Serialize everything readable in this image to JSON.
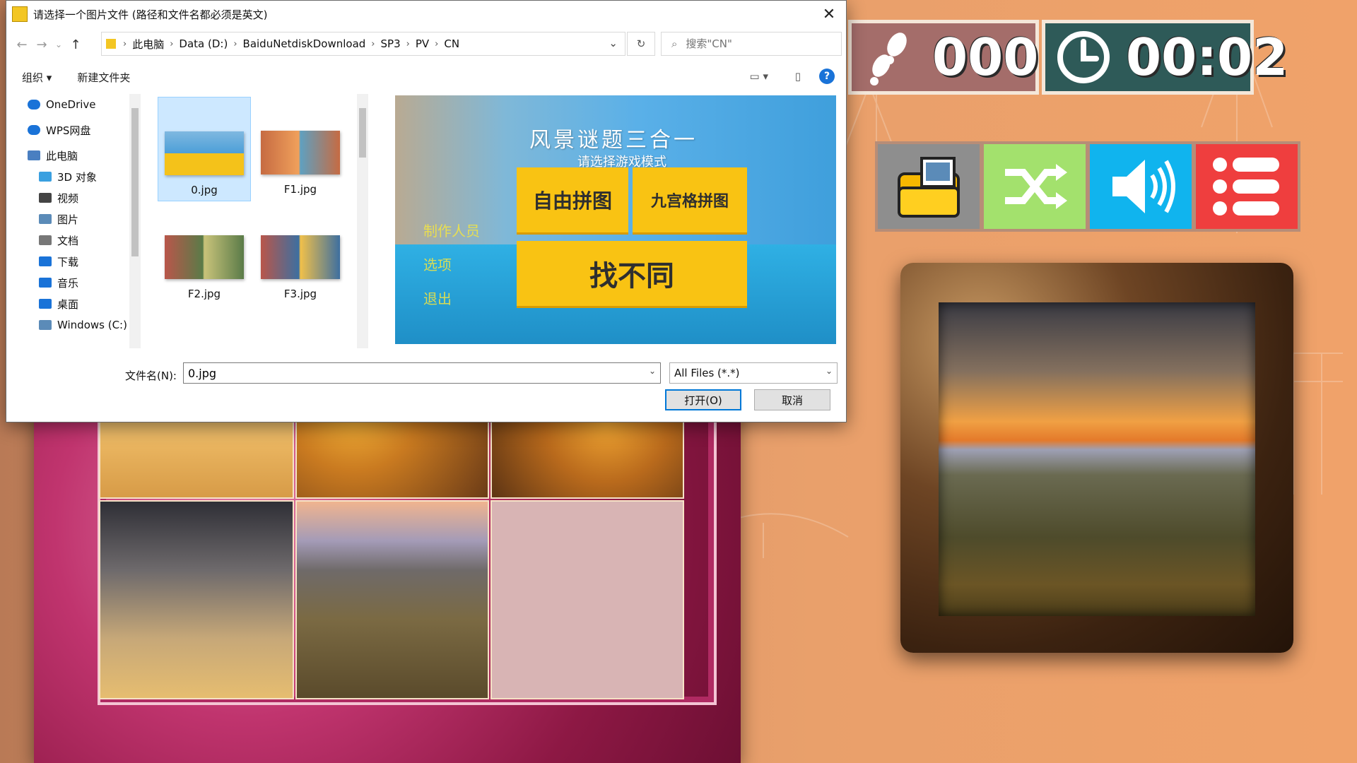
{
  "game": {
    "steps": "000",
    "timer": "00:02",
    "toolbar": [
      "folder-image-icon",
      "shuffle-icon",
      "sound-icon",
      "menu-list-icon"
    ]
  },
  "dialog": {
    "title": "请选择一个图片文件 (路径和文件名都必须是英文)",
    "breadcrumbs": [
      "此电脑",
      "Data (D:)",
      "BaiduNetdiskDownload",
      "SP3",
      "PV",
      "CN"
    ],
    "search_placeholder": "搜索\"CN\"",
    "commands": {
      "organize": "组织 ▾",
      "new_folder": "新建文件夹"
    },
    "nav_items": [
      {
        "label": "OneDrive",
        "icon": "cloud-icon"
      },
      {
        "label": "WPS网盘",
        "icon": "cloud-icon"
      },
      {
        "label": "此电脑",
        "icon": "computer-icon"
      },
      {
        "label": "3D 对象",
        "icon": "cube-icon"
      },
      {
        "label": "视频",
        "icon": "video-icon"
      },
      {
        "label": "图片",
        "icon": "picture-icon"
      },
      {
        "label": "文档",
        "icon": "document-icon"
      },
      {
        "label": "下载",
        "icon": "download-icon"
      },
      {
        "label": "音乐",
        "icon": "music-icon"
      },
      {
        "label": "桌面",
        "icon": "desktop-icon"
      },
      {
        "label": "Windows (C:)",
        "icon": "drive-icon"
      }
    ],
    "files": [
      "0.jpg",
      "F1.jpg",
      "F2.jpg",
      "F3.jpg"
    ],
    "preview": {
      "title": "风景谜题三合一",
      "subtitle": "请选择游戏模式",
      "mode_free": "自由拼图",
      "mode_grid": "九宫格拼图",
      "mode_diff": "找不同",
      "menu": [
        "制作人员",
        "选项",
        "退出"
      ]
    },
    "filename_label": "文件名(N):",
    "filename_value": "0.jpg",
    "filetype": "All Files (*.*)",
    "open_label": "打开(O)",
    "cancel_label": "取消",
    "colors": {
      "accent": "#0078d7",
      "selection": "#cde8ff",
      "preview_button": "#f9c313"
    }
  }
}
